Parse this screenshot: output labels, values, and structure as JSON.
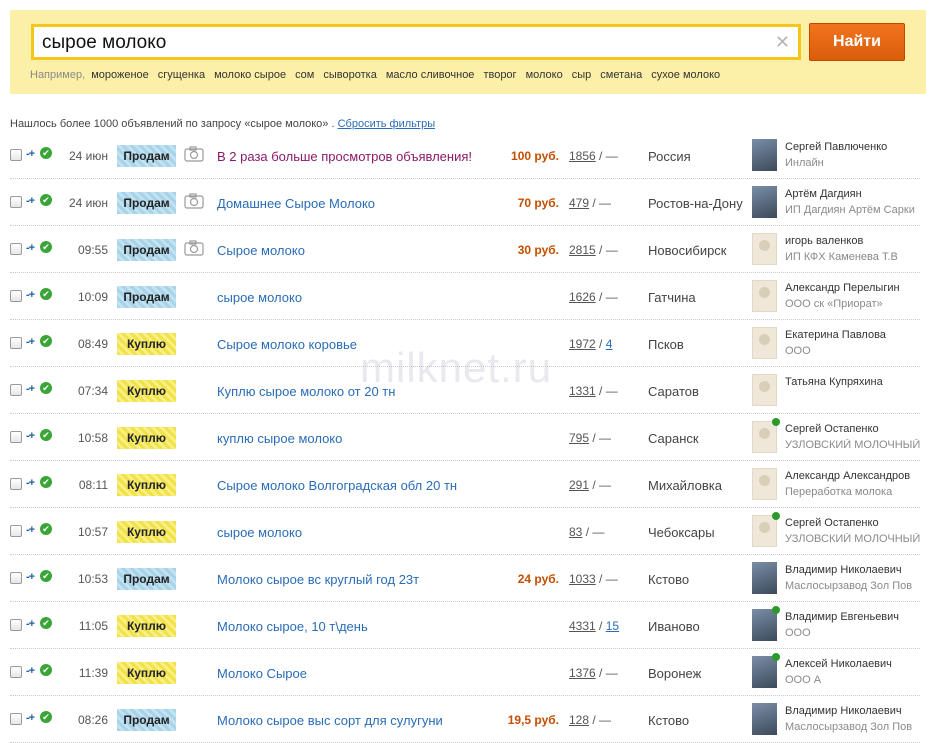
{
  "search": {
    "query": "сырое молоко",
    "button_label": "Найти",
    "clear_icon": "close-icon",
    "examples_lead": "Например,",
    "examples": [
      "мороженое",
      "сгущенка",
      "молоко сырое",
      "сом",
      "сыворотка",
      "масло сливочное",
      "творог",
      "молоко",
      "сыр",
      "сметана",
      "сухое молоко"
    ]
  },
  "results": {
    "info_text": "Нашлось более 1000 объявлений по запросу «сырое молоко» .",
    "reset_label": "Сбросить фильтры"
  },
  "listings": [
    {
      "date": "24 июн",
      "type": "Продам",
      "kind": "sell",
      "camera": true,
      "title": "В 2 раза больше просмотров объявления!",
      "ad": true,
      "price": "100 руб.",
      "views": "1856",
      "replies": "—",
      "city": "Россия",
      "avatar": "photo",
      "online": false,
      "name": "Сергей Павлюченко",
      "company": "Инлайн"
    },
    {
      "date": "24 июн",
      "type": "Продам",
      "kind": "sell",
      "camera": true,
      "title": "Домашнее Сырое Молоко",
      "ad": false,
      "price": "70 руб.",
      "views": "479",
      "replies": "—",
      "city": "Ростов-на-Дону",
      "avatar": "photo",
      "online": false,
      "name": "Артём Дагдиян",
      "company": "ИП Дагдиян Артём Сарки"
    },
    {
      "date": "09:55",
      "type": "Продам",
      "kind": "sell",
      "camera": true,
      "title": "Сырое молоко",
      "ad": false,
      "price": "30 руб.",
      "views": "2815",
      "replies": "—",
      "city": "Новосибирск",
      "avatar": "placeholder",
      "online": false,
      "name": "игорь валенков",
      "company": "ИП КФХ Каменева Т.В"
    },
    {
      "date": "10:09",
      "type": "Продам",
      "kind": "sell",
      "camera": false,
      "title": "сырое молоко",
      "ad": false,
      "price": "",
      "views": "1626",
      "replies": "—",
      "city": "Гатчина",
      "avatar": "placeholder",
      "online": false,
      "name": "Александр Перелыгин",
      "company": "ООО ск «Приорат»"
    },
    {
      "date": "08:49",
      "type": "Куплю",
      "kind": "buy",
      "camera": false,
      "title": "Сырое молоко коровье",
      "ad": false,
      "price": "",
      "views": "1972",
      "replies": "4",
      "city": "Псков",
      "avatar": "placeholder",
      "online": false,
      "name": "Екатерина Павлова",
      "company": "ООО"
    },
    {
      "date": "07:34",
      "type": "Куплю",
      "kind": "buy",
      "camera": false,
      "title": "Куплю сырое молоко от 20 тн",
      "ad": false,
      "price": "",
      "views": "1331",
      "replies": "—",
      "city": "Саратов",
      "avatar": "placeholder",
      "online": false,
      "name": "Татьяна Купряхина",
      "company": ""
    },
    {
      "date": "10:58",
      "type": "Куплю",
      "kind": "buy",
      "camera": false,
      "title": "куплю сырое молоко",
      "ad": false,
      "price": "",
      "views": "795",
      "replies": "—",
      "city": "Саранск",
      "avatar": "placeholder",
      "online": true,
      "name": "Сергей Остапенко",
      "company": "УЗЛОВСКИЙ МОЛОЧНЫЙ"
    },
    {
      "date": "08:11",
      "type": "Куплю",
      "kind": "buy",
      "camera": false,
      "title": "Сырое молоко Волгоградская обл 20 тн",
      "ad": false,
      "price": "",
      "views": "291",
      "replies": "—",
      "city": "Михайловка",
      "avatar": "placeholder",
      "online": false,
      "name": "Александр Александров",
      "company": "Переработка молока"
    },
    {
      "date": "10:57",
      "type": "Куплю",
      "kind": "buy",
      "camera": false,
      "title": "сырое молоко",
      "ad": false,
      "price": "",
      "views": "83",
      "replies": "—",
      "city": "Чебоксары",
      "avatar": "placeholder",
      "online": true,
      "name": "Сергей Остапенко",
      "company": "УЗЛОВСКИЙ МОЛОЧНЫЙ"
    },
    {
      "date": "10:53",
      "type": "Продам",
      "kind": "sell",
      "camera": false,
      "title": "Молоко сырое вс круглый год 23т",
      "ad": false,
      "price": "24 руб.",
      "views": "1033",
      "replies": "—",
      "city": "Кстово",
      "avatar": "photo",
      "online": false,
      "name": "Владимир Николаевич",
      "company": "Маслосырзавод Зол Пов"
    },
    {
      "date": "11:05",
      "type": "Куплю",
      "kind": "buy",
      "camera": false,
      "title": "Молоко сырое, 10 т\\день",
      "ad": false,
      "price": "",
      "views": "4331",
      "replies": "15",
      "city": "Иваново",
      "avatar": "photo",
      "online": true,
      "name": "Владимир Евгеньевич",
      "company": "ООО"
    },
    {
      "date": "11:39",
      "type": "Куплю",
      "kind": "buy",
      "camera": false,
      "title": "Молоко Сырое",
      "ad": false,
      "price": "",
      "views": "1376",
      "replies": "—",
      "city": "Воронеж",
      "avatar": "photo",
      "online": true,
      "name": "Алексей Николаевич",
      "company": "ООО А"
    },
    {
      "date": "08:26",
      "type": "Продам",
      "kind": "sell",
      "camera": false,
      "title": "Молоко сырое выс сорт для сулугуни",
      "ad": false,
      "price": "19,5 руб.",
      "views": "128",
      "replies": "—",
      "city": "Кстово",
      "avatar": "photo",
      "online": false,
      "name": "Владимир Николаевич",
      "company": "Маслосырзавод Зол Пов"
    }
  ],
  "watermark": "milknet.ru"
}
